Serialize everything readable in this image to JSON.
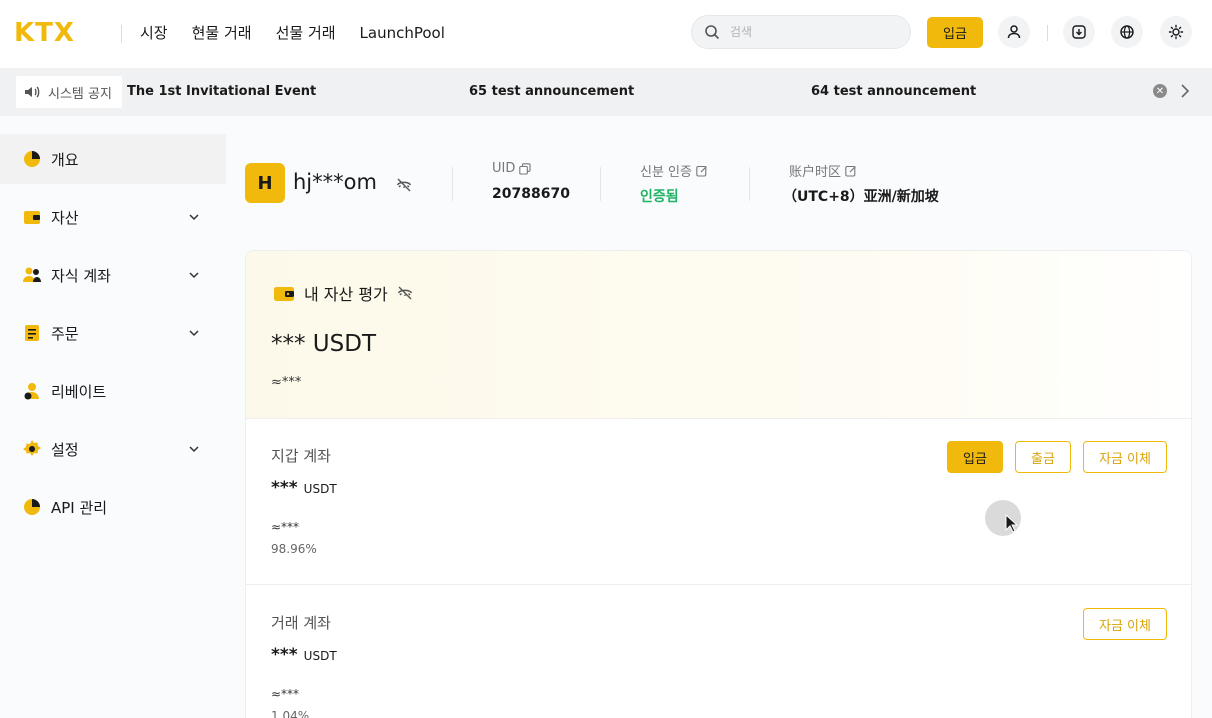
{
  "header": {
    "logo_letters": [
      "K",
      "T",
      "X"
    ],
    "nav": [
      "시장",
      "현물 거래",
      "선물 거래",
      "LaunchPool"
    ],
    "search_placeholder": "검색",
    "deposit_label": "입금"
  },
  "announcements": {
    "tag": "시스템 공지",
    "items": [
      "The 1st Invitational Event",
      "65 test announcement",
      "64 test announcement"
    ]
  },
  "sidebar": {
    "items": [
      {
        "label": "개요",
        "icon": "overview-icon",
        "expandable": false
      },
      {
        "label": "자산",
        "icon": "wallet-icon",
        "expandable": true
      },
      {
        "label": "자식 계좌",
        "icon": "users-icon",
        "expandable": true
      },
      {
        "label": "주문",
        "icon": "order-icon",
        "expandable": true
      },
      {
        "label": "리베이트",
        "icon": "rebate-icon",
        "expandable": false
      },
      {
        "label": "설정",
        "icon": "settings-icon",
        "expandable": true
      },
      {
        "label": "API 관리",
        "icon": "api-icon",
        "expandable": false
      }
    ]
  },
  "profile": {
    "avatar_letter": "H",
    "username": "hj***om",
    "uid_label": "UID",
    "uid_value": "20788670",
    "kyc_label": "신분 인증",
    "kyc_value": "인증됨",
    "timezone_label": "账户时区",
    "timezone_value": "（UTC+8）亚洲/新加坡"
  },
  "assets": {
    "title": "내 자산 평가",
    "total_value": "*** USDT",
    "total_approx": "≈***"
  },
  "wallet": {
    "title": "지갑 계좌",
    "value": "***",
    "unit": "USDT",
    "approx": "≈***",
    "percent": "98.96%",
    "buttons": {
      "deposit": "입금",
      "withdraw": "출금",
      "transfer": "자금 이체"
    }
  },
  "trade": {
    "title": "거래 계좌",
    "value": "***",
    "unit": "USDT",
    "approx": "≈***",
    "percent": "1.04%",
    "buttons": {
      "transfer": "자금 이체"
    }
  },
  "colors": {
    "accent": "#f0b90b",
    "verified": "#21b365"
  }
}
